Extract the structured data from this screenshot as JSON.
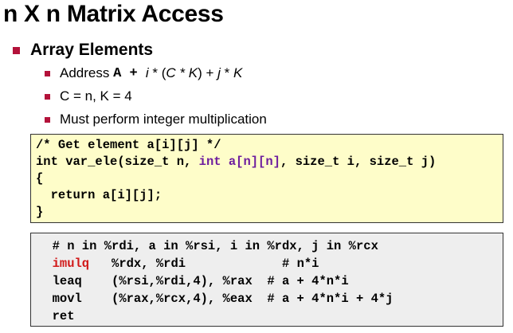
{
  "title": "n X n Matrix Access",
  "bullet": "Array Elements",
  "sub_items": {
    "addr_prefix": "Address ",
    "addr_mono": "A + ",
    "addr_i": "i",
    "addr_mid1": " * (",
    "addr_CK": "C * K",
    "addr_mid2": ") + ",
    "addr_j": "j",
    "addr_mid3": " * ",
    "addr_K": "K",
    "ck": "C = n, K = 4",
    "must": "Must perform integer multiplication"
  },
  "c_code": {
    "comment": "/* Get element a[i][j] */",
    "sig_a": "int var_ele(size_t n, ",
    "sig_b": "int a[n][n]",
    "sig_c": ", size_t i, size_t j)",
    "open": "{",
    "ret": "  return a[i][j];",
    "close": "}"
  },
  "asm": {
    "comment": "  # n in %rdi, a in %rsi, i in %rdx, j in %rcx",
    "l1_op": "  imulq",
    "l1_rest": "   %rdx, %rdi             # n*i",
    "l2": "  leaq    (%rsi,%rdi,4), %rax  # a + 4*n*i",
    "l3": "  movl    (%rax,%rcx,4), %eax  # a + 4*n*i + 4*j",
    "l4": "  ret"
  },
  "colors": {
    "bullet": "#b3123a",
    "code_bg": "#fefdc9",
    "asm_bg": "#eeeeee",
    "highlight_purple": "#6d1d9e",
    "highlight_red": "#d11919"
  }
}
